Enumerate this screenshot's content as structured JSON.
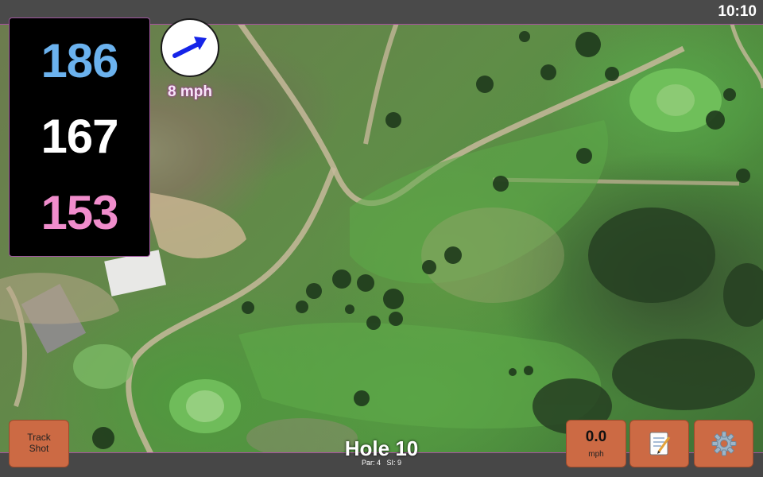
{
  "status_bar": {
    "time": "10:10"
  },
  "distances": {
    "back": "186",
    "middle": "167",
    "front": "153"
  },
  "wind": {
    "speed_label": "8 mph",
    "direction_icon": "arrow-icon"
  },
  "buttons": {
    "track_shot_label": "Track\nShot",
    "wind_value": "0.0",
    "wind_unit": "mph",
    "notes_icon": "notepad-icon",
    "settings_icon": "gear-icon"
  },
  "hole": {
    "title": "Hole 10",
    "par_label": "Par: 4",
    "si_label": "SI: 9"
  },
  "colors": {
    "back_distance": "#6bb2ee",
    "middle_distance": "#ffffff",
    "front_distance": "#f08dcc",
    "button_bg": "#cc6a44",
    "wind_arrow": "#1524e8"
  }
}
